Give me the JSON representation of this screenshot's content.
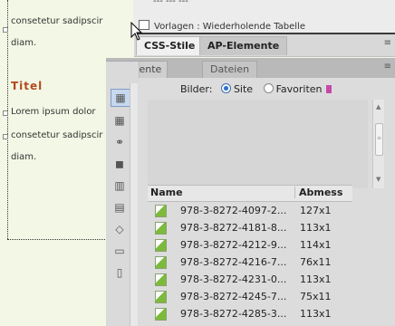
{
  "document": {
    "lines_top": [
      "consetetur sadipscir",
      "diam."
    ],
    "title": "Titel",
    "lines_bottom": [
      "Lorem ipsum dolor",
      "consetetur sadipscir",
      "diam."
    ]
  },
  "top_strip": {
    "cut_text": "--- --- ---",
    "row_text": "Vorlagen : Wiederholende Tabelle"
  },
  "css_panel": {
    "tabs": [
      "CSS-Stile",
      "AP-Elemente"
    ],
    "menu_icon": "≡"
  },
  "assets_panel": {
    "tabs": [
      "Elemente",
      "Dateien"
    ],
    "menu_icon": "≡",
    "bilder_label": "Bilder:",
    "radio_site": "Site",
    "radio_favoriten": "Favoriten",
    "columns": [
      "Name",
      "Abmess"
    ],
    "files": [
      {
        "name": "978-3-8272-4097-2...",
        "dims": "127x1"
      },
      {
        "name": "978-3-8272-4181-8...",
        "dims": "113x1"
      },
      {
        "name": "978-3-8272-4212-9...",
        "dims": "114x1"
      },
      {
        "name": "978-3-8272-4216-7...",
        "dims": "76x11"
      },
      {
        "name": "978-3-8272-4231-0...",
        "dims": "113x1"
      },
      {
        "name": "978-3-8272-4245-7...",
        "dims": "75x11"
      },
      {
        "name": "978-3-8272-4285-3...",
        "dims": "113x1"
      }
    ]
  },
  "icon_strip": [
    "image-icon",
    "grid-icon",
    "link-icon",
    "flash-icon",
    "movie-icon",
    "script-icon",
    "library-icon",
    "template-icon",
    "book-icon"
  ]
}
